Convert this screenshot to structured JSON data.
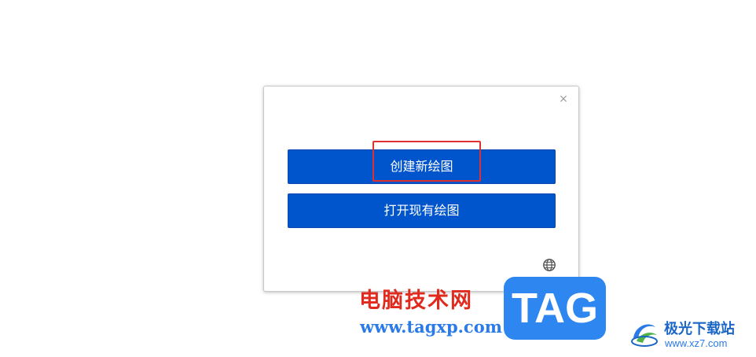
{
  "dialog": {
    "close_glyph": "×",
    "new_diagram_label": "创建新绘图",
    "open_existing_label": "打开现有绘图",
    "language_icon": "globe-icon"
  },
  "colors": {
    "button_bg": "#0155cc",
    "highlight_border": "#e03131"
  },
  "watermark": {
    "site_name": "电脑技术网",
    "site_url": "www.tagxp.com",
    "tag_logo": "TAG",
    "brand2_name": "极光下载站",
    "brand2_url": "www.xz7.com"
  }
}
